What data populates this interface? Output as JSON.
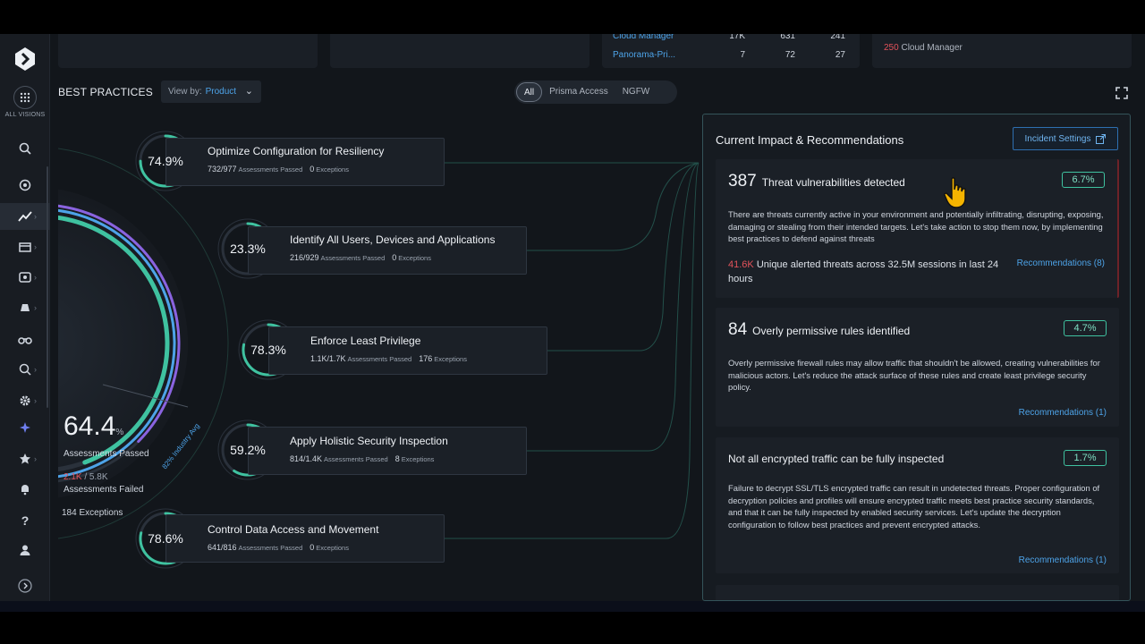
{
  "top_cards": {
    "rows": [
      {
        "name": "Cloud Manager",
        "a": "17K",
        "b": "631",
        "c": "241"
      },
      {
        "name": "Panorama-Pri...",
        "a": "7",
        "b": "72",
        "c": "27"
      }
    ],
    "cloud_manager_count": "250",
    "cloud_manager_label": "Cloud Manager"
  },
  "sidebar": {
    "all_visions_label": "ALL VISIONS",
    "icons": [
      "search-icon",
      "target-icon",
      "dashboard-icon",
      "cube-icon",
      "globe-icon",
      "bell-book-icon",
      "binoculars-icon",
      "shield-search-icon",
      "settings-icon",
      "sparkle-icon",
      "star-icon",
      "notification-icon",
      "help-icon",
      "user-icon",
      "expand-icon"
    ]
  },
  "header": {
    "title": "BEST PRACTICES",
    "view_by_label": "View by:",
    "view_by_value": "Product",
    "filters": [
      "All",
      "Prisma Access",
      "NGFW"
    ],
    "active_filter": "All"
  },
  "overall": {
    "percent": "64.4",
    "percent_unit": "%",
    "passed_label": "Assessments Passed",
    "failed_value": "2.1K",
    "failed_total": "/ 5.8K",
    "failed_label": "Assessments Failed",
    "exceptions": "184 Exceptions",
    "industry_label": "82% Industry Avg",
    "ring_fraction": 0.644,
    "industry_fraction": 0.82
  },
  "practices": [
    {
      "pct": "74.9%",
      "fraction": 0.749,
      "title": "Optimize Configuration for Resiliency",
      "passed": "732/977",
      "passed_label": "Assessments Passed",
      "exceptions": "0",
      "exceptions_label": "Exceptions"
    },
    {
      "pct": "23.3%",
      "fraction": 0.233,
      "title": "Identify All Users, Devices and Applications",
      "passed": "216/929",
      "passed_label": "Assessments Passed",
      "exceptions": "0",
      "exceptions_label": "Exceptions"
    },
    {
      "pct": "78.3%",
      "fraction": 0.783,
      "title": "Enforce Least Privilege",
      "passed": "1.1K/1.7K",
      "passed_label": "Assessments Passed",
      "exceptions": "176",
      "exceptions_label": "Exceptions"
    },
    {
      "pct": "59.2%",
      "fraction": 0.592,
      "title": "Apply Holistic Security Inspection",
      "passed": "814/1.4K",
      "passed_label": "Assessments Passed",
      "exceptions": "8",
      "exceptions_label": "Exceptions"
    },
    {
      "pct": "78.6%",
      "fraction": 0.786,
      "title": "Control Data Access and Movement",
      "passed": "641/816",
      "passed_label": "Assessments Passed",
      "exceptions": "0",
      "exceptions_label": "Exceptions"
    }
  ],
  "panel": {
    "title": "Current Impact & Recommendations",
    "incident_settings": "Incident Settings",
    "cards": [
      {
        "count": "387",
        "heading": "Threat vulnerabilities detected",
        "badge": "6.7%",
        "body": "There are threats currently active in your environment and potentially infiltrating, disrupting, exposing, damaging or stealing from their intended targets. Let's take action to stop them now, by implementing best practices to defend against threats",
        "alert_value": "41.6K",
        "alert_text": "Unique alerted threats across 32.5M sessions in last 24 hours",
        "link": "Recommendations (8)"
      },
      {
        "count": "84",
        "heading": "Overly permissive rules identified",
        "badge": "4.7%",
        "body": "Overly permissive firewall rules may allow traffic that shouldn't be allowed, creating vulnerabilities for malicious actors. Let's reduce the attack surface of these rules and create least privilege security policy.",
        "link": "Recommendations (1)"
      },
      {
        "count": "",
        "heading": "Not all encrypted traffic can be fully inspected",
        "badge": "1.7%",
        "body": "Failure to decrypt SSL/TLS encrypted traffic can result in undetected threats. Proper configuration of decryption policies and profiles will ensure encrypted traffic meets best practice security standards, and that it can be fully inspected by enabled security services. Let's update the decryption configuration to follow best practices and prevent encrypted attacks.",
        "link": "Recommendations (1)"
      }
    ]
  },
  "colors": {
    "accent_teal": "#3fc2a0",
    "accent_blue": "#4da3e8",
    "alert_red": "#e2525a",
    "ring_purple": "#8a63e0"
  }
}
